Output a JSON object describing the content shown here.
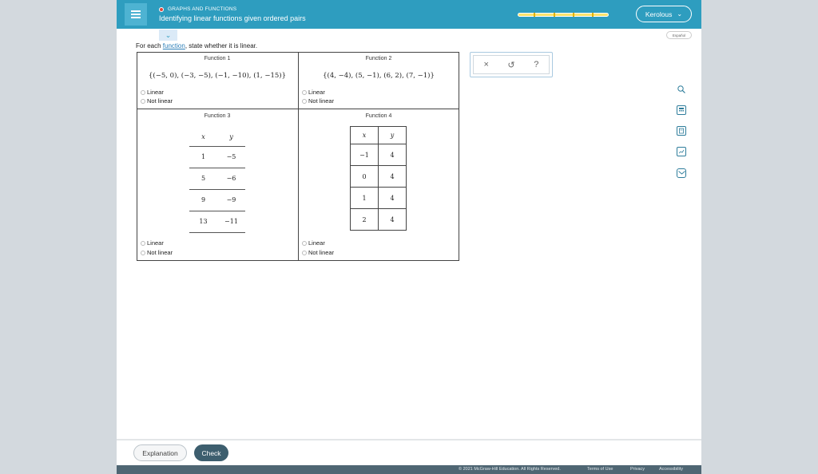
{
  "header": {
    "topic": "GRAPHS AND FUNCTIONS",
    "title": "Identifying linear functions given ordered pairs",
    "progress_fraction": 0.72,
    "user_name": "Kerolous",
    "accent_color": "#2e9dbf",
    "menu_icon": "hamburger-icon",
    "user_chevron_icon": "chevron-down-icon"
  },
  "collapse_icon": "chevron-down-icon",
  "espanol_label": "Español",
  "instruction": {
    "before": "For each ",
    "link": "function",
    "after": ", state whether it is linear."
  },
  "functions": {
    "f1": {
      "title": "Function 1",
      "set": "{(−5, 0), (−3, −5), (−1, −10), (1, −15)}"
    },
    "f2": {
      "title": "Function 2",
      "set": "{(4, −4), (5, −1), (6, 2), (7, −1)}"
    },
    "f3": {
      "title": "Function 3",
      "x_header": "x",
      "y_header": "y",
      "rows": [
        {
          "x": "1",
          "y": "−5"
        },
        {
          "x": "5",
          "y": "−6"
        },
        {
          "x": "9",
          "y": "−9"
        },
        {
          "x": "13",
          "y": "−11"
        }
      ]
    },
    "f4": {
      "title": "Function 4",
      "x_header": "x",
      "y_header": "y",
      "rows": [
        {
          "x": "−1",
          "y": "4"
        },
        {
          "x": "0",
          "y": "4"
        },
        {
          "x": "1",
          "y": "4"
        },
        {
          "x": "2",
          "y": "4"
        }
      ]
    }
  },
  "options": {
    "linear": "Linear",
    "not_linear": "Not linear"
  },
  "answer_tools": {
    "clear": "×",
    "undo": "↺",
    "help": "?"
  },
  "side_tools": [
    "search-icon",
    "calculator-icon",
    "ebook-icon",
    "graph-icon",
    "mail-icon"
  ],
  "footer": {
    "explanation_label": "Explanation",
    "check_label": "Check",
    "copyright": "© 2021 McGraw-Hill Education. All Rights Reserved.",
    "terms": "Terms of Use",
    "privacy": "Privacy",
    "accessibility": "Accessibility"
  }
}
